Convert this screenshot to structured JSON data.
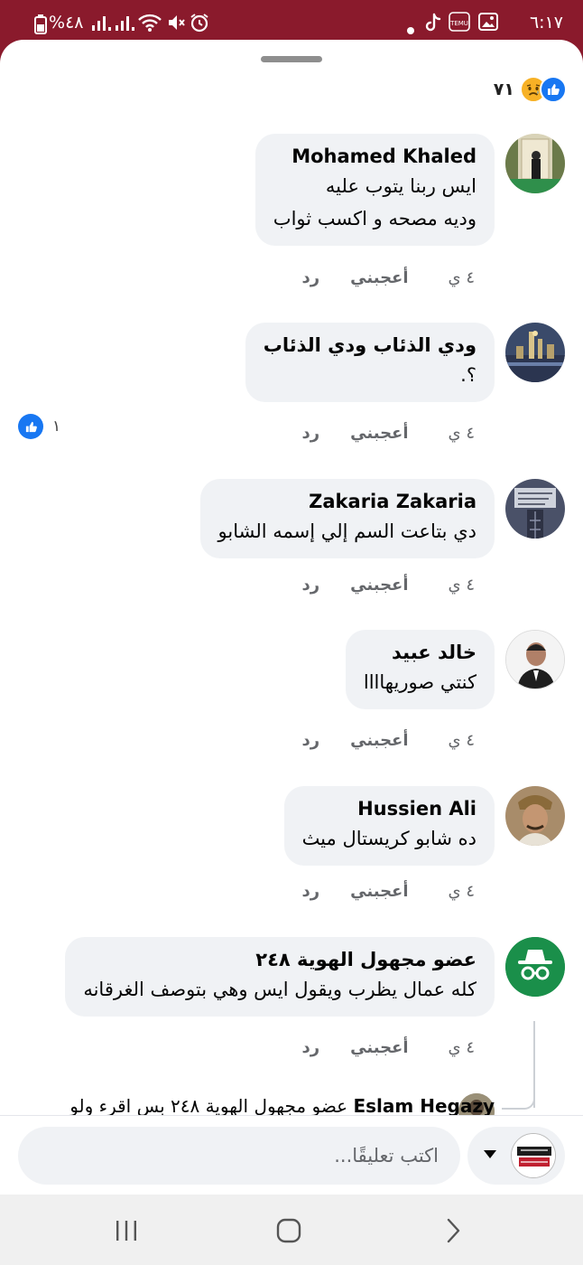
{
  "status_bar": {
    "time": "٦:١٧",
    "battery": "%٤٨"
  },
  "post": {
    "reaction_count": "٧١",
    "reaction_icons": [
      "like-icon",
      "sad-face-icon"
    ]
  },
  "comments": [
    {
      "name": "Mohamed Khaled",
      "lines": [
        "ايس ربنا يتوب عليه",
        "وديه مصحه و اكسب ثواب"
      ],
      "time": "٤ ي",
      "like": "أعجبني",
      "reply": "رد"
    },
    {
      "name": "ودي الذئاب ودي الذئاب",
      "lines": [
        "؟."
      ],
      "time": "٤ ي",
      "like": "أعجبني",
      "reply": "رد",
      "reactions": "١"
    },
    {
      "name": "Zakaria Zakaria",
      "lines": [
        "دي بتاعت السم إلي إسمه الشابو"
      ],
      "time": "٤ ي",
      "like": "أعجبني",
      "reply": "رد"
    },
    {
      "name": "خالد عبيد",
      "lines": [
        "كنتي صوريهاااا"
      ],
      "time": "٤ ي",
      "like": "أعجبني",
      "reply": "رد"
    },
    {
      "name": "Hussien Ali",
      "lines": [
        "ده شابو كريستال ميث"
      ],
      "time": "٤ ي",
      "like": "أعجبني",
      "reply": "رد"
    },
    {
      "name": "عضو مجهول الهوية ٢٤٨",
      "lines": [
        "كله عمال يظرب ويقول ايس وهي بتوصف الغرقانه"
      ],
      "time": "٤ ي",
      "like": "أعجبني",
      "reply": "رد"
    }
  ],
  "reply_preview": {
    "name": "Eslam Hegazy",
    "text": "عضو مجهول الهوية ٢٤٨ بس اقرء ولو"
  },
  "composer": {
    "placeholder": "اكتب تعليقًا..."
  },
  "colors": {
    "status_bar": "#8a1a2c",
    "bubble": "#f0f2f5",
    "like_blue": "#1877f2",
    "anon_green": "#1a8f4a"
  }
}
